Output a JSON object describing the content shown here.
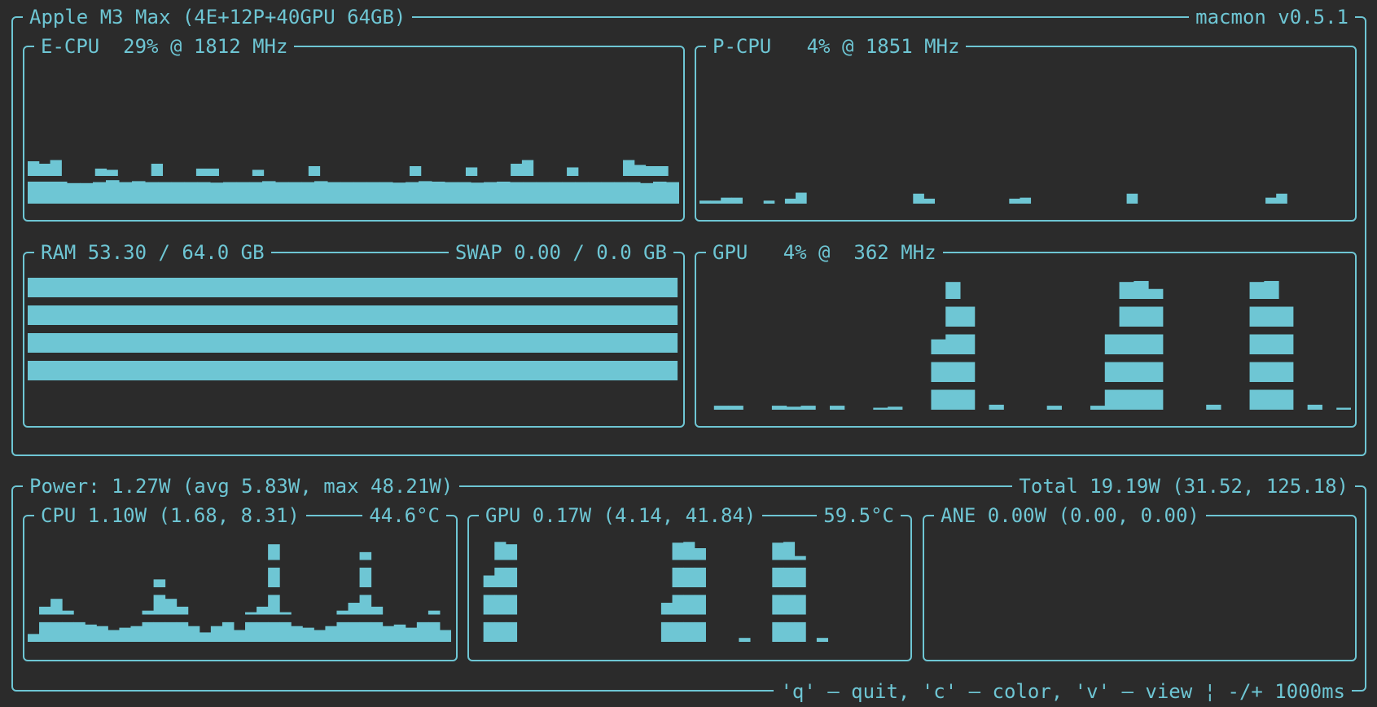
{
  "device": "Apple M3 Max (4E+12P+40GPU 64GB)",
  "app_version": "macmon v0.5.1",
  "ecpu": {
    "title": "E-CPU  29% @ 1812 MHz",
    "history": [
      0.45,
      0.45,
      0.45,
      0.42,
      0.42,
      0.44,
      0.48,
      0.44,
      0.46,
      0.44,
      0.44,
      0.44,
      0.44,
      0.44,
      0.43,
      0.44,
      0.44,
      0.44,
      0.46,
      0.44,
      0.44,
      0.44,
      0.46,
      0.44,
      0.44,
      0.44,
      0.44,
      0.44,
      0.43,
      0.44,
      0.46,
      0.45,
      0.44,
      0.44,
      0.43,
      0.44,
      0.45,
      0.44,
      0.44,
      0.44,
      0.44,
      0.44,
      0.44,
      0.44,
      0.44,
      0.44,
      0.44,
      0.42,
      0.45,
      0.44
    ],
    "peaks": [
      [
        0,
        0.62
      ],
      [
        1,
        0.6
      ],
      [
        2,
        0.63
      ],
      [
        6,
        0.56
      ],
      [
        7,
        0.55
      ],
      [
        11,
        0.6
      ],
      [
        15,
        0.56
      ],
      [
        16,
        0.56
      ],
      [
        20,
        0.55
      ],
      [
        25,
        0.58
      ],
      [
        34,
        0.58
      ],
      [
        39,
        0.57
      ],
      [
        43,
        0.6
      ],
      [
        44,
        0.63
      ],
      [
        48,
        0.57
      ],
      [
        53,
        0.63
      ],
      [
        54,
        0.59
      ],
      [
        55,
        0.58
      ],
      [
        56,
        0.58
      ]
    ]
  },
  "pcpu": {
    "title": "P-CPU   4% @ 1851 MHz",
    "history": [
      0.03,
      0.03,
      0.06,
      0.06,
      0,
      0,
      0.03,
      0,
      0.05,
      0.11,
      0.02,
      0,
      0,
      0,
      0,
      0,
      0,
      0,
      0,
      0,
      0.1,
      0.05,
      0,
      0,
      0,
      0,
      0,
      0,
      0,
      0.05,
      0.06,
      0,
      0,
      0,
      0,
      0,
      0,
      0,
      0,
      0,
      0.1,
      0,
      0,
      0,
      0,
      0,
      0,
      0,
      0,
      0,
      0,
      0,
      0,
      0.06,
      0.1,
      0,
      0,
      0,
      0,
      0.02,
      0.02
    ]
  },
  "ram": {
    "title": "RAM 53.30 / 64.0 GB",
    "swap_title": "SWAP 0.00 / 0.0 GB",
    "usage_pct": 83.3
  },
  "gpu": {
    "title": "GPU   4% @  362 MHz",
    "history": [
      0,
      0.04,
      0.04,
      0,
      0,
      0.04,
      0.03,
      0.04,
      0,
      0.04,
      0,
      0,
      0.02,
      0.03,
      0,
      0,
      0.55,
      0.97,
      0.8,
      0,
      0.05,
      0,
      0,
      0,
      0.04,
      0,
      0,
      0.04,
      0.6,
      0.97,
      0.98,
      0.9,
      0,
      0,
      0,
      0.05,
      0,
      0,
      0.97,
      0.98,
      0.8,
      0,
      0.05,
      0,
      0.02
    ]
  },
  "power": {
    "title": "Power: 1.27W (avg 5.83W, max 48.21W)",
    "total": "Total 19.19W (31.52, 125.18)"
  },
  "cpu_power": {
    "title": "CPU 1.10W (1.68, 8.31)",
    "temp": "44.6°C",
    "history": [
      0.1,
      0.35,
      0.45,
      0.3,
      0.25,
      0.22,
      0.2,
      0.15,
      0.18,
      0.2,
      0.3,
      0.6,
      0.45,
      0.35,
      0.2,
      0.12,
      0.2,
      0.25,
      0.15,
      0.28,
      0.35,
      0.95,
      0.28,
      0.2,
      0.18,
      0.15,
      0.2,
      0.3,
      0.4,
      0.85,
      0.35,
      0.2,
      0.22,
      0.18,
      0.25,
      0.3,
      0.15
    ]
  },
  "gpu_power": {
    "title": "GPU 0.17W (4.14, 41.84)",
    "temp": "59.5°C",
    "history": [
      0,
      0.65,
      0.98,
      0.95,
      0,
      0,
      0,
      0,
      0,
      0,
      0,
      0,
      0,
      0,
      0,
      0,
      0,
      0.4,
      0.97,
      0.98,
      0.9,
      0,
      0,
      0,
      0.05,
      0,
      0,
      0.97,
      0.98,
      0.8,
      0,
      0.05,
      0,
      0,
      0,
      0,
      0,
      0,
      0
    ]
  },
  "ane_power": {
    "title": "ANE 0.00W (0.00, 0.00)",
    "history": []
  },
  "help": "'q' – quit, 'c' – color, 'v' – view ¦ -/+ 1000ms"
}
